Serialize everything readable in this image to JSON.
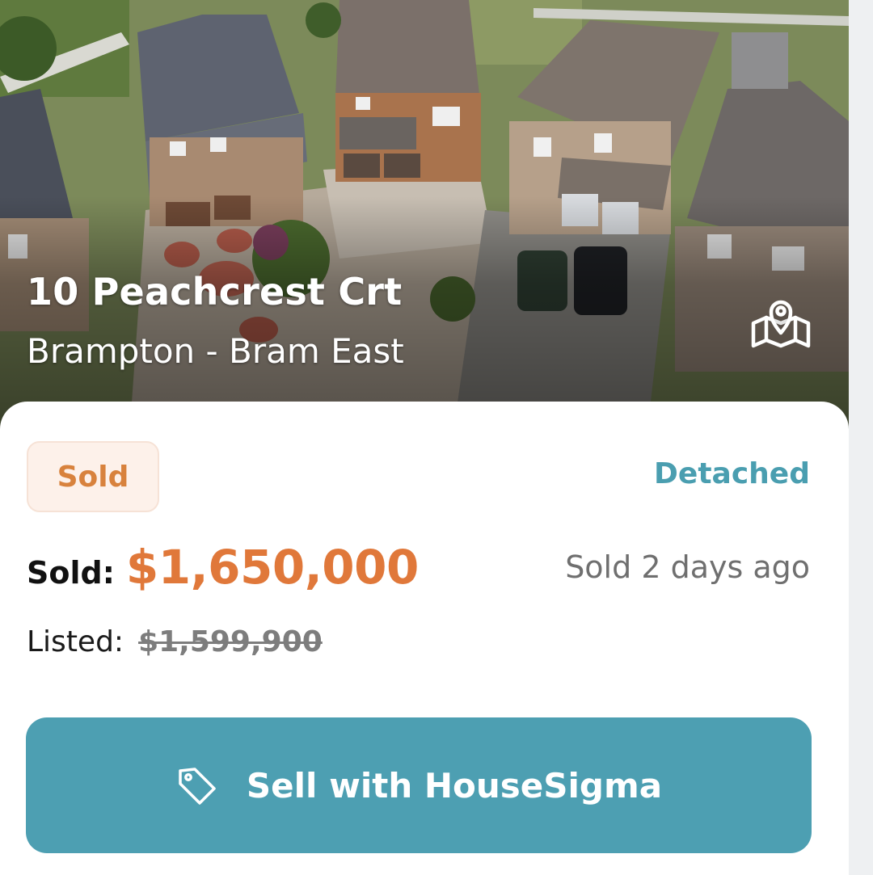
{
  "listing": {
    "address": "10 Peachcrest Crt",
    "community": "Brampton - Bram East",
    "status": "Sold",
    "property_type": "Detached",
    "sold_label": "Sold:",
    "sold_price": "$1,650,000",
    "sold_ago": "Sold 2 days ago",
    "listed_label": "Listed:",
    "listed_price": "$1,599,900"
  },
  "actions": {
    "sell_button_label": "Sell with HouseSigma",
    "sell_button_icon": "tag-icon",
    "map_button_icon": "map-pin-icon"
  },
  "colors": {
    "sold_price": "#e0783a",
    "status_badge_text": "#d8823d",
    "status_badge_bg": "#fdf1ea",
    "property_type": "#4a9eb0",
    "sell_button_bg": "#4d9fb2"
  }
}
